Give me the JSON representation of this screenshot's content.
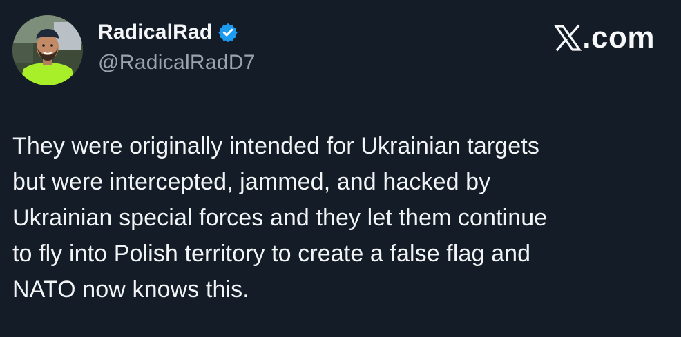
{
  "author": {
    "display_name": "RadicalRad",
    "handle": "@RadicalRadD7",
    "verified": true,
    "avatar_icon": "profile-photo"
  },
  "brand": {
    "label": ".com",
    "logo_icon": "x-logo-icon"
  },
  "tweet": {
    "text": "They were originally intended for Ukrainian targets\nbut were intercepted, jammed, and hacked by\nUkrainian special forces and they let them continue\nto fly into Polish territory to create a false flag and\nNATO now knows this."
  },
  "colors": {
    "background": "#141d27",
    "verified_badge": "#1d9bf0",
    "handle": "#9aa4ae",
    "text": "#f2f4f6"
  }
}
